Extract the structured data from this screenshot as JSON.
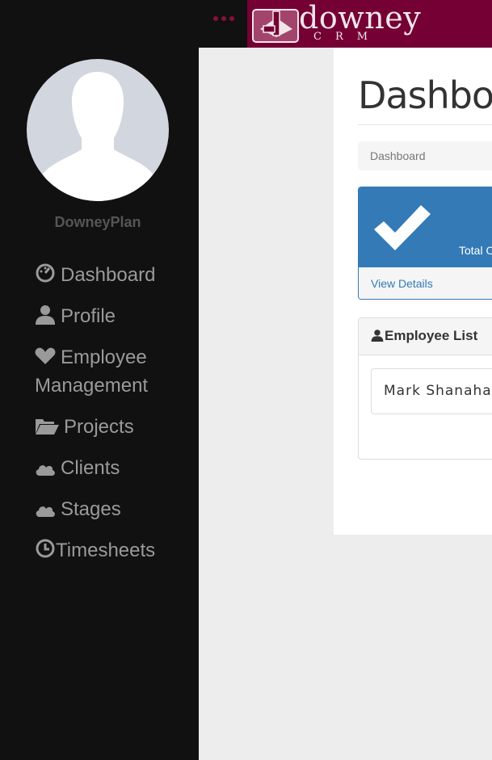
{
  "brand": {
    "name": "downey",
    "sub": "CRM"
  },
  "user": {
    "name": "DowneyPlan"
  },
  "nav": [
    {
      "label": "Dashboard",
      "icon": "dashboard-icon"
    },
    {
      "label": "Profile",
      "icon": "user-icon"
    },
    {
      "label": "Employee Management",
      "icon": "heart-icon"
    },
    {
      "label": "Projects",
      "icon": "folder-open-icon"
    },
    {
      "label": "Clients",
      "icon": "cloud-icon"
    },
    {
      "label": "Stages",
      "icon": "cloud-icon"
    },
    {
      "label": "Timesheets",
      "icon": "clock-icon"
    }
  ],
  "page": {
    "title": "Dashboard",
    "breadcrumb": "Dashboard",
    "stat_card": {
      "text": "Total O",
      "link": "View Details",
      "color": "#337ab7"
    },
    "employee_panel": {
      "title": "Employee List",
      "items": [
        "Mark Shanahan"
      ]
    }
  },
  "colors": {
    "brand": "#750034",
    "sidebar": "#111111",
    "accent": "#337ab7"
  }
}
